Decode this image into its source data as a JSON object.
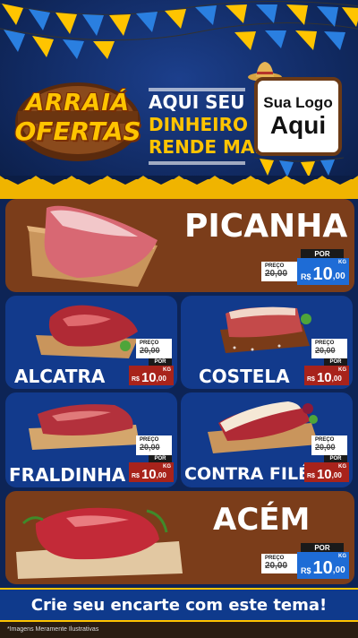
{
  "header": {
    "logo_line1": "ARRAIÁ",
    "logo_line2": "OFERTAS",
    "slogan": [
      "AQUI SEU",
      "DINHEIRO",
      "RENDE MAIS!"
    ],
    "brand_box_line1": "Sua Logo",
    "brand_box_line2": "Aqui"
  },
  "products": [
    {
      "name": "PICANHA",
      "por": "POR",
      "preco_label": "PREÇO",
      "old_price": "20,00",
      "currency": "R$",
      "price_int": "10",
      "price_cents": ",00",
      "unit": "KG",
      "icon": "picanha-cut-image"
    },
    {
      "name": "ALCATRA",
      "por": "POR",
      "preco_label": "PREÇO",
      "old_price": "20,00",
      "currency": "R$",
      "price_int": "10",
      "price_cents": ",00",
      "unit": "KG",
      "icon": "alcatra-cut-image"
    },
    {
      "name": "COSTELA",
      "por": "POR",
      "preco_label": "PREÇO",
      "old_price": "20,00",
      "currency": "R$",
      "price_int": "10",
      "price_cents": ",00",
      "unit": "KG",
      "icon": "costela-cut-image"
    },
    {
      "name": "FRALDINHA",
      "por": "POR",
      "preco_label": "PREÇO",
      "old_price": "20,00",
      "currency": "R$",
      "price_int": "10",
      "price_cents": ",00",
      "unit": "KG",
      "icon": "fraldinha-cut-image"
    },
    {
      "name": "CONTRA FILÉ",
      "por": "POR",
      "preco_label": "PREÇO",
      "old_price": "20,00",
      "currency": "R$",
      "price_int": "10",
      "price_cents": ",00",
      "unit": "KG",
      "icon": "contra-file-cut-image"
    },
    {
      "name": "ACÉM",
      "por": "POR",
      "preco_label": "PREÇO",
      "old_price": "20,00",
      "currency": "R$",
      "price_int": "10",
      "price_cents": ",00",
      "unit": "KG",
      "icon": "acem-cut-image"
    }
  ],
  "footer": {
    "cta": "Crie seu encarte com este tema!",
    "disclaimer": "*Imagens Meramente Ilustrativas"
  },
  "colors": {
    "navy": "#0d2456",
    "brown_card": "#7b3d1a",
    "blue_card": "#123a8c",
    "yellow": "#ffc400",
    "price_blue": "#1e6cd6",
    "price_red": "#a8231b"
  }
}
